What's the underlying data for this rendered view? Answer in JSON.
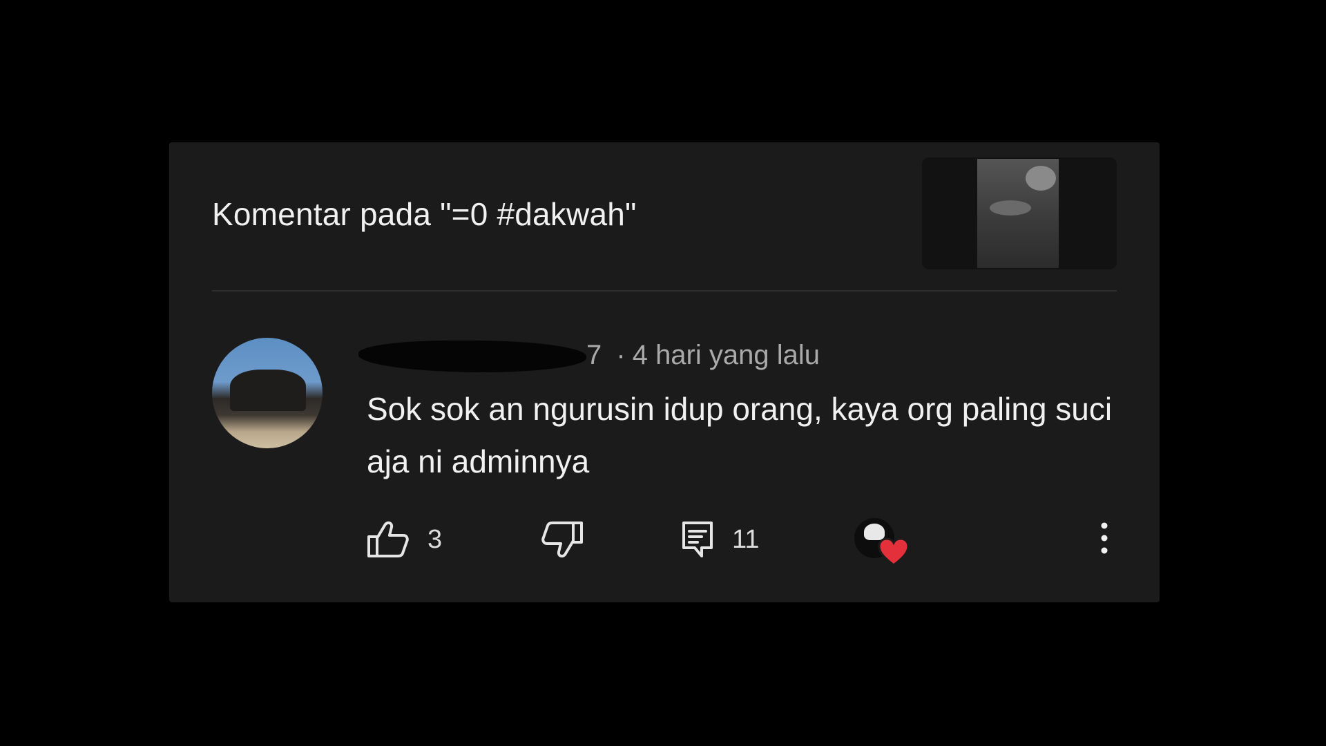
{
  "header": {
    "title": "Komentar pada \"=0 #dakwah\""
  },
  "comment": {
    "author_suffix": "7",
    "separator": "·",
    "timestamp": "4 hari yang lalu",
    "body": "Sok sok an ngurusin idup orang, kaya org paling suci aja ni adminnya",
    "likes": "3",
    "replies": "11",
    "creator_heart": true
  },
  "icons": {
    "like": "thumbs-up-icon",
    "dislike": "thumbs-down-icon",
    "reply": "reply-comment-icon",
    "heart": "heart-icon",
    "more": "more-vertical-icon"
  },
  "colors": {
    "background": "#000000",
    "card": "#1b1b1b",
    "text_primary": "#f1f1f1",
    "text_secondary": "#aaaaaa",
    "heart": "#e3303a"
  }
}
